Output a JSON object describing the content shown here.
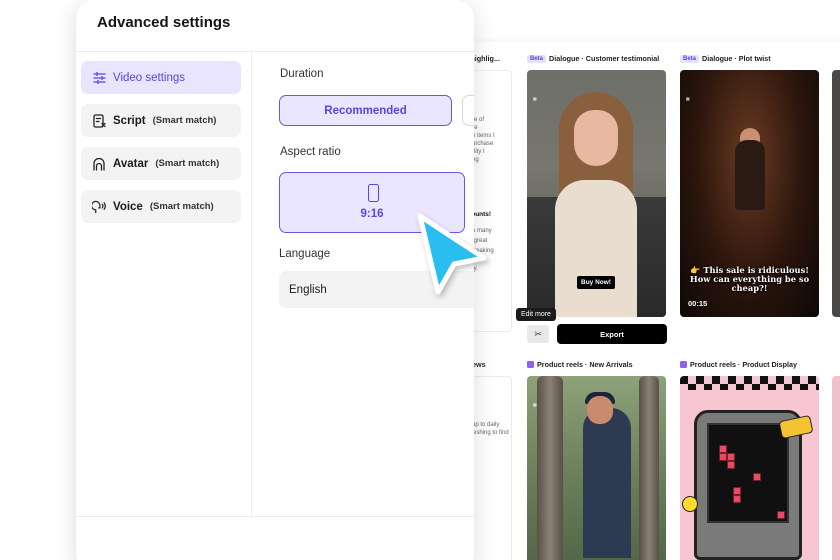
{
  "dialog": {
    "title": "Advanced settings",
    "nav": [
      {
        "label": "Video settings",
        "sub": "",
        "icon": "sliders-icon",
        "active": true
      },
      {
        "label": "Script",
        "sub": "(Smart match)",
        "icon": "script-icon",
        "active": false
      },
      {
        "label": "Avatar",
        "sub": "(Smart match)",
        "icon": "avatar-icon",
        "active": false
      },
      {
        "label": "Voice",
        "sub": "(Smart match)",
        "icon": "voice-icon",
        "active": false
      }
    ],
    "duration": {
      "label": "Duration",
      "selected": "Recommended"
    },
    "aspect_ratio": {
      "label": "Aspect ratio",
      "selected": "9:16",
      "icon": "portrait-phone-icon"
    },
    "language": {
      "label": "Language",
      "value": "English"
    }
  },
  "gallery": {
    "row1": {
      "partial_label": "ct highlig...",
      "cards": [
        {
          "badge": "Beta",
          "title": "Dialogue · Customer testimonial",
          "overlay": "Buy Now!"
        },
        {
          "badge": "Beta",
          "title": "Dialogue · Plot twist",
          "caption": "👉 This sale is ridiculous! How can everything be so cheap?!",
          "time": "00:15"
        }
      ],
      "partial_doc": {
        "lines": [
          "ange of",
          ". The",
          "y on items I",
          "y purchase",
          "quality I",
          "pping"
        ],
        "bold": "scounts!",
        "lines2": [
          "d so many",
          "s a great",
          "ht breaking",
          "",
          "easy."
        ]
      }
    },
    "tooltip": "Edit more",
    "export_label": "Export",
    "row2": {
      "partial_label": "eviews",
      "partial_doc_lines": [
        "setup to daily",
        "refreshing to find"
      ],
      "cards": [
        {
          "title": "Product reels · New Arrivals"
        },
        {
          "title": "Product reels · Product Display"
        }
      ]
    }
  },
  "colors": {
    "accent": "#5b45e0",
    "accent_bg": "#ebe6ff",
    "cursor": "#2bbdf0"
  }
}
